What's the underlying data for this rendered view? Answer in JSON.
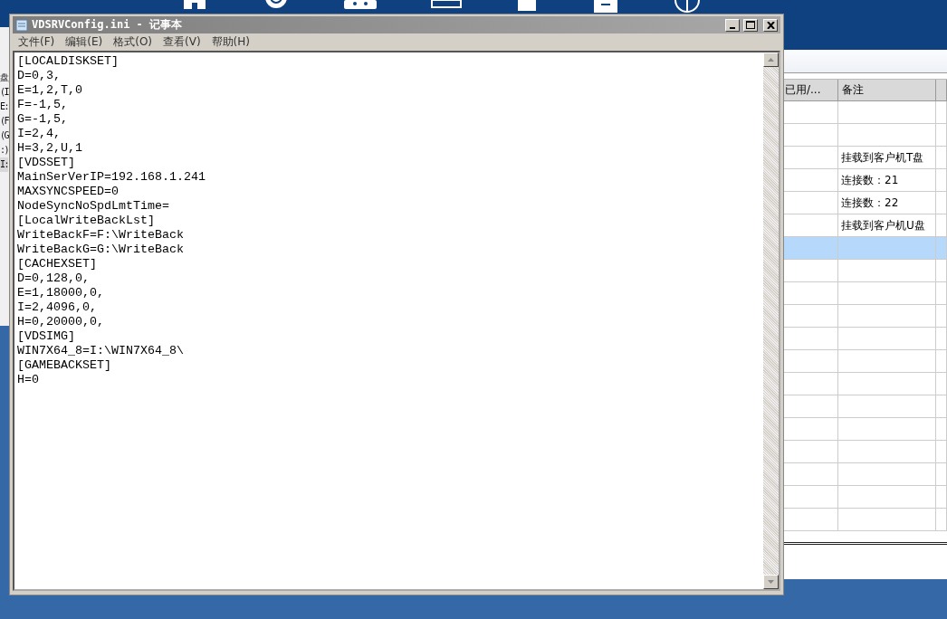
{
  "background_window": {
    "fragments": [
      "盘",
      "(I",
      "E:",
      "(F",
      "(G",
      ":)",
      "I:"
    ]
  },
  "notepad": {
    "title": "VDSRVConfig.ini - 记事本",
    "menu": [
      "文件(F)",
      "编辑(E)",
      "格式(O)",
      "查看(V)",
      "帮助(H)"
    ],
    "lines": [
      "[LOCALDISKSET]",
      "D=0,3,",
      "E=1,2,T,0",
      "F=-1,5,",
      "G=-1,5,",
      "I=2,4,",
      "H=3,2,U,1",
      "[VDSSET]",
      "MainSerVerIP=192.168.1.241",
      "MAXSYNCSPEED=0",
      "NodeSyncNoSpdLmtTime=",
      "[LocalWriteBackLst]",
      "WriteBackF=F:\\WriteBack",
      "WriteBackG=G:\\WriteBack",
      "[CACHEXSET]",
      "D=0,128,0,",
      "E=1,18000,0,",
      "I=2,4096,0,",
      "H=0,20000,0,",
      "[VDSIMG]",
      "WIN7X64_8=I:\\WIN7X64_8\\",
      "[GAMEBACKSET]",
      "H=0"
    ]
  },
  "table": {
    "columns": [
      "已用/...",
      "备注"
    ],
    "rows": [
      {
        "selected": false
      },
      {
        "selected": false
      },
      {
        "selected": false,
        "note": "挂载到客户机T盘"
      },
      {
        "selected": false,
        "note": "连接数：21"
      },
      {
        "selected": false,
        "note": "连接数：22"
      },
      {
        "selected": false,
        "note": "挂载到客户机U盘"
      },
      {
        "selected": true
      },
      {
        "selected": false
      },
      {
        "selected": false
      },
      {
        "selected": false
      },
      {
        "selected": false
      },
      {
        "selected": false
      },
      {
        "selected": false
      },
      {
        "selected": false
      },
      {
        "selected": false
      },
      {
        "selected": false
      },
      {
        "selected": false
      },
      {
        "selected": false
      },
      {
        "selected": false
      }
    ]
  }
}
